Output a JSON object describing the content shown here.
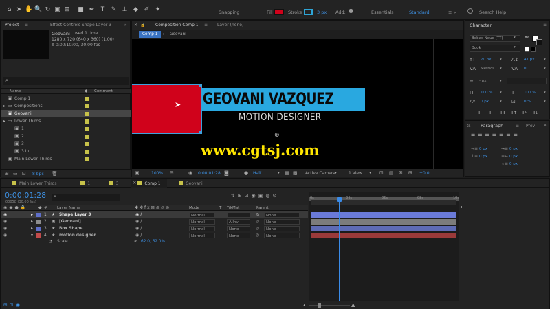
{
  "toolbar": {
    "tools": [
      {
        "icon": "home-icon",
        "glyph": "⌂"
      },
      {
        "icon": "selection-icon",
        "glyph": "➤"
      },
      {
        "icon": "hand-icon",
        "glyph": "✋"
      },
      {
        "icon": "zoom-icon",
        "glyph": "🔍"
      },
      {
        "icon": "rotate-icon",
        "glyph": "↻"
      },
      {
        "icon": "camera-icon",
        "glyph": "▣"
      },
      {
        "icon": "pan-behind-icon",
        "glyph": "⊞"
      },
      {
        "icon": "rectangle-tool-icon",
        "glyph": "■"
      },
      {
        "icon": "pen-tool-icon",
        "glyph": "✒"
      },
      {
        "icon": "type-tool-icon",
        "glyph": "T"
      },
      {
        "icon": "brush-tool-icon",
        "glyph": "✎"
      },
      {
        "icon": "clone-stamp-icon",
        "glyph": "⊥"
      },
      {
        "icon": "eraser-icon",
        "glyph": "◆"
      },
      {
        "icon": "roto-brush-icon",
        "glyph": "✐"
      },
      {
        "icon": "puppet-pin-icon",
        "glyph": "✦"
      }
    ],
    "snapping": "Snapping",
    "fill": "Fill",
    "stroke": "Stroke",
    "stroke_px": "3 px",
    "add_label": "Add:",
    "workspace_essentials": "Essentials",
    "workspace_standard": "Standard",
    "search": "Search Help"
  },
  "project": {
    "tab_project": "Project",
    "tab_effects": "Effect Controls Shape Layer 3",
    "item_name": "Geovani",
    "used": ", used 1 time",
    "dims": "1280 x 720  (640 x 360) (1.00)",
    "duration": "Δ 0:00:10:00, 30.00 fps",
    "col_name": "Name",
    "col_comment": "Comment",
    "items": [
      {
        "label": "Comp 1",
        "indent": 0,
        "icon": "comp-icon",
        "color": "#c7c24a",
        "selected": false
      },
      {
        "label": "Compositions",
        "indent": 0,
        "icon": "folder-icon",
        "color": "#c7c24a",
        "selected": false
      },
      {
        "label": "Geovani",
        "indent": 0,
        "icon": "comp-icon",
        "color": "#c7c24a",
        "selected": true
      },
      {
        "label": "Lower Thirds",
        "indent": 0,
        "icon": "folder-icon",
        "color": "#c7c24a",
        "selected": false
      },
      {
        "label": "1",
        "indent": 1,
        "icon": "comp-icon",
        "color": "#c7c24a",
        "selected": false
      },
      {
        "label": "2",
        "indent": 1,
        "icon": "comp-icon",
        "color": "#c7c24a",
        "selected": false
      },
      {
        "label": "3",
        "indent": 1,
        "icon": "comp-icon",
        "color": "#c7c24a",
        "selected": false
      },
      {
        "label": "3 In",
        "indent": 1,
        "icon": "comp-icon",
        "color": "#c7c24a",
        "selected": false
      },
      {
        "label": "Main Lower Thirds",
        "indent": 0,
        "icon": "comp-icon",
        "color": "#c7c24a",
        "selected": false
      }
    ],
    "bpc": "8 bpc"
  },
  "composition": {
    "tab_comp": "Composition Comp 1",
    "tab_layer": "Layer (none)",
    "crumb_1": "Comp 1",
    "crumb_2": "Geovani",
    "title": "GEOVANI VAZQUEZ",
    "subtitle": "MOTION DESIGNER",
    "watermark": "www.cgtsj.com",
    "zoom": "100%",
    "timecode": "0:00:01:28",
    "resolution": "Half",
    "camera": "Active Camera",
    "view": "1 View",
    "exposure": "+0.0"
  },
  "character": {
    "title": "Character",
    "font": "Bebas Neue (TT)",
    "style": "Book",
    "size": "70 px",
    "leading": "41 px",
    "kerning": "Metrics",
    "tracking": "0",
    "stroke_width": "- px",
    "stroke_type": "",
    "vscale": "100 %",
    "hscale": "100 %",
    "baseline": "0 px",
    "tsume": "0 %",
    "styles": [
      "T",
      "T",
      "TT",
      "Tт",
      "T¹",
      "T₁"
    ]
  },
  "paragraph": {
    "tab_left": "ts",
    "tab": "Paragraph",
    "tab_right": "Prev",
    "indent": [
      "0 px",
      "0 px",
      "0 px",
      "0 px",
      "0 px"
    ]
  },
  "timeline": {
    "tabs": [
      {
        "label": "Main Lower Thirds",
        "active": false
      },
      {
        "label": "1",
        "active": false
      },
      {
        "label": "3",
        "active": false
      },
      {
        "label": "Comp 1",
        "active": true
      },
      {
        "label": "Geovani",
        "active": false
      }
    ],
    "timecode": "0:00:01:28",
    "frame": "00058 (30.00 fps)",
    "col_layer": "Layer Name",
    "col_mode": "Mode",
    "col_t": "T",
    "col_trkmat": "TrkMat",
    "col_parent": "Parent",
    "layers": [
      {
        "num": "1",
        "name": "Shape Layer 3",
        "color": "#5f6fc9",
        "mode": "Normal",
        "trkmat": "",
        "parent": "None",
        "bar": "#6a7ad8",
        "selected": true
      },
      {
        "num": "2",
        "name": "[Geovani]",
        "color": "#8d8d8d",
        "mode": "Normal",
        "trkmat": "A.Inv",
        "parent": "None",
        "bar": "#7c7c7c",
        "selected": false
      },
      {
        "num": "3",
        "name": "Box Shape",
        "color": "#5f6fc9",
        "mode": "Normal",
        "trkmat": "None",
        "parent": "None",
        "bar": "#5e6bb5",
        "selected": false
      },
      {
        "num": "4",
        "name": "motion designer",
        "color": "#c24b4b",
        "mode": "Normal",
        "trkmat": "None",
        "parent": "None",
        "bar": "#9a3a3a",
        "selected": false
      }
    ],
    "scale_label": "Scale",
    "scale_value": "62.0, 62.0%",
    "ruler": [
      "0s",
      "04s",
      "05s",
      "08s",
      "10s"
    ],
    "playhead": 0.195
  }
}
